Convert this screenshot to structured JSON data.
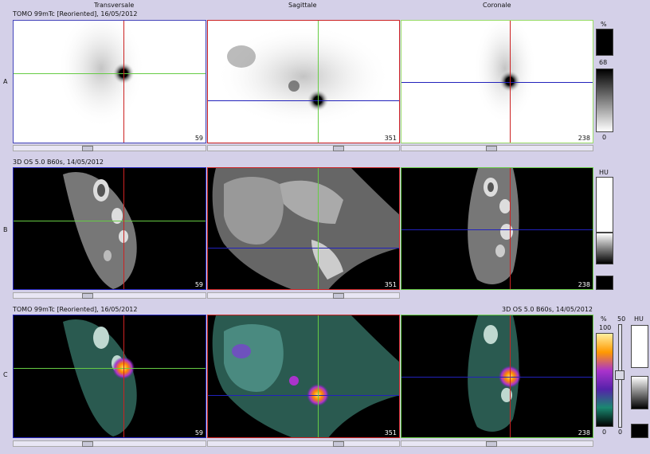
{
  "columns": [
    "Transversale",
    "Sagittale",
    "Coronale"
  ],
  "rows": [
    {
      "label": "A",
      "title": "TOMO 99mTc [Reoriented], 16/05/2012"
    },
    {
      "label": "B",
      "title": "3D OS 5.0 B60s, 14/05/2012"
    },
    {
      "label": "C",
      "title_left": "TOMO 99mTc [Reoriented], 16/05/2012",
      "title_right": "3D OS 5.0 B60s, 14/05/2012"
    }
  ],
  "slices": [
    "59",
    "351",
    "238"
  ],
  "scale_a": {
    "unit": "%",
    "top": "68",
    "bottom": "0"
  },
  "scale_b": {
    "unit": "HU"
  },
  "scale_c": {
    "unit_left": "%",
    "top_left": "100",
    "bottom_left": "0",
    "top_mid": "50",
    "bottom_mid": "0",
    "unit_right": "HU"
  },
  "colors": {
    "red": "#cc2222",
    "green": "#66cc44",
    "blue": "#2222bb",
    "lightgreen": "#99dd66"
  }
}
